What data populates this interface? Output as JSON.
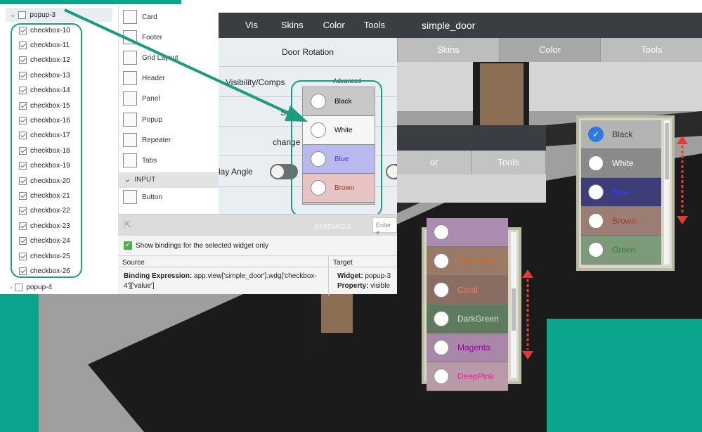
{
  "tree": {
    "parent_open": "popup-3",
    "children": [
      "checkbox-10",
      "checkbox-11",
      "checkbox-12",
      "checkbox-13",
      "checkbox-14",
      "checkbox-15",
      "checkbox-16",
      "checkbox-17",
      "checkbox-18",
      "checkbox-19",
      "checkbox-20",
      "checkbox-21",
      "checkbox-22",
      "checkbox-23",
      "checkbox-24",
      "checkbox-25",
      "checkbox-26"
    ],
    "parent_closed": "popup-4"
  },
  "palette": {
    "items": [
      "Card",
      "Footer",
      "Grid Layout",
      "Header",
      "Panel",
      "Popup",
      "Repeater",
      "Tabs"
    ],
    "section": "INPUT",
    "after_section": [
      "Button"
    ]
  },
  "preview": {
    "header_items": [
      "Vis",
      "Skins",
      "Color",
      "Tools"
    ],
    "rows": {
      "door_rotation": "Door Rotation",
      "visibility": "Visibility/Comps",
      "advanced": "Advanced",
      "select": "Sele",
      "change": "change",
      "angle": "lay Angle"
    },
    "dropdown": [
      "Black",
      "White",
      "Blue",
      "Brown"
    ]
  },
  "bindings": {
    "title": "BINDINGS",
    "search_placeholder": "Enter a",
    "show_label": "Show bindings for the selected widget only",
    "source_header": "Source",
    "target_header": "Target",
    "expr_label": "Binding Expression:",
    "expr_value": "app.view['simple_door'].wdg['checkbox-4']['value']",
    "widget_label": "Widget:",
    "widget_value": "popup-3",
    "property_label": "Property:",
    "property_value": "visible"
  },
  "door_panel": {
    "title": "simple_door",
    "tabs": [
      "Skins",
      "Color",
      "Tools"
    ]
  },
  "mid_panel": {
    "tabs": [
      "or",
      "Tools"
    ]
  },
  "picker_right": {
    "options": [
      {
        "label": "Black",
        "bg": "#b3b3b3",
        "fg": "#333333",
        "checked": true
      },
      {
        "label": "White",
        "bg": "#8a8a8a",
        "fg": "#ffffff"
      },
      {
        "label": "Blue",
        "bg": "#3d3d7a",
        "fg": "#3a3aff"
      },
      {
        "label": "Brown",
        "bg": "#9c7d73",
        "fg": "#9c3f22"
      },
      {
        "label": "Green",
        "bg": "#7c9a7a",
        "fg": "#2a7f2a"
      }
    ]
  },
  "picker_left": {
    "options": [
      {
        "label": "",
        "bg": "#a98cb0",
        "fg": "#333333"
      },
      {
        "label": "Chocolate",
        "bg": "#9a7a66",
        "fg": "#d2691e"
      },
      {
        "label": "Coral",
        "bg": "#8a6d63",
        "fg": "#ff7f50"
      },
      {
        "label": "DarkGreen",
        "bg": "#5f7a5c",
        "fg": "#cfe8cf"
      },
      {
        "label": "Magenta",
        "bg": "#a987a8",
        "fg": "#a000a0"
      },
      {
        "label": "DeepPink",
        "bg": "#b89aa8",
        "fg": "#ff1493"
      }
    ]
  }
}
